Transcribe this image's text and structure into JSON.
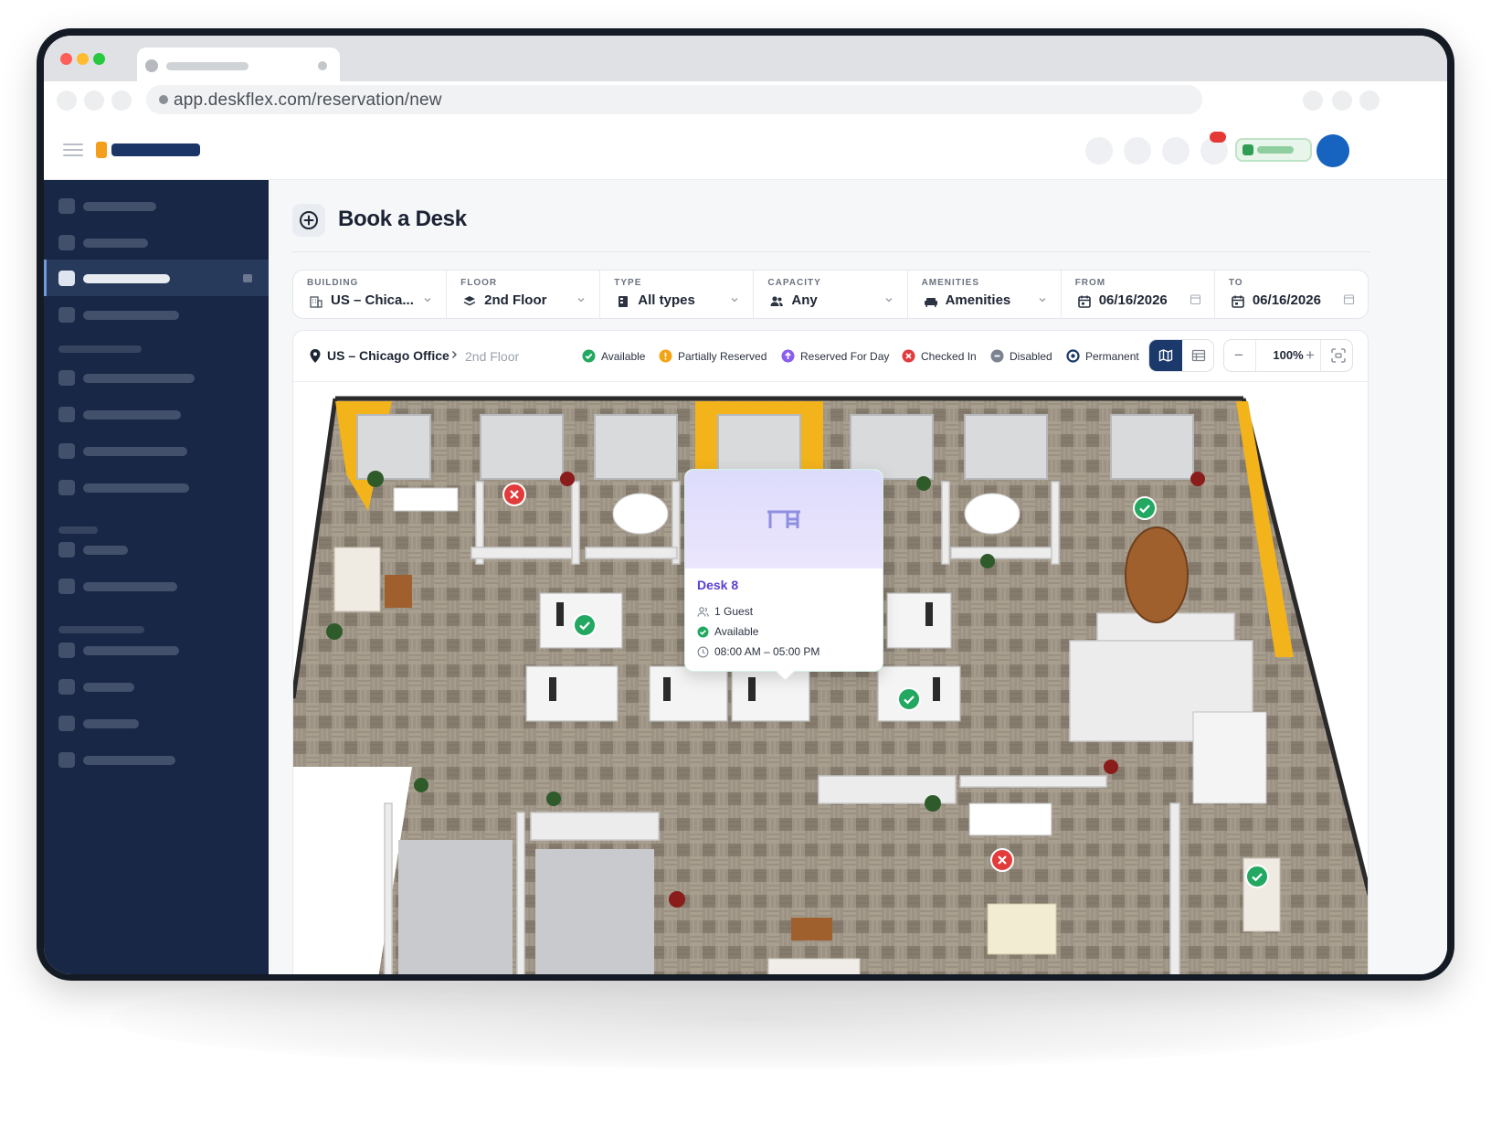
{
  "browser": {
    "url": "app.deskflex.com/reservation/new"
  },
  "page": {
    "title": "Book a Desk"
  },
  "filters": [
    {
      "label": "BUILDING",
      "value": "US – Chica...",
      "icon": "building-icon"
    },
    {
      "label": "FLOOR",
      "value": "2nd Floor",
      "icon": "layers-icon"
    },
    {
      "label": "TYPE",
      "value": "All types",
      "icon": "desk-type-icon"
    },
    {
      "label": "CAPACITY",
      "value": "Any",
      "icon": "users-icon"
    },
    {
      "label": "AMENITIES",
      "value": "Amenities",
      "icon": "sofa-icon"
    },
    {
      "label": "FROM",
      "value": "06/16/2026",
      "icon": "calendar-icon"
    },
    {
      "label": "TO",
      "value": "06/16/2026",
      "icon": "calendar-icon"
    }
  ],
  "breadcrumb": {
    "office": "US – Chicago Office",
    "floor": "2nd Floor"
  },
  "legend": [
    {
      "label": "Available",
      "color": "#22a861",
      "icon": "check-circle-icon"
    },
    {
      "label": "Partially Reserved",
      "color": "#f2a413",
      "icon": "exclamation-circle-icon"
    },
    {
      "label": "Reserved For Day",
      "color": "#8a5cf0",
      "icon": "arrow-up-circle-icon"
    },
    {
      "label": "Checked In",
      "color": "#e23b3b",
      "icon": "x-circle-icon"
    },
    {
      "label": "Disabled",
      "color": "#7b8290",
      "icon": "minus-circle-icon"
    },
    {
      "label": "Permanent",
      "color": "#1b3a6b",
      "icon": "ring-circle-icon"
    }
  ],
  "zoom": {
    "value": "100%",
    "minus": "−",
    "plus": "+"
  },
  "popup": {
    "title": "Desk 8",
    "capacity": "1 Guest",
    "status": "Available",
    "hours": "08:00 AM – 05:00 PM"
  },
  "colors": {
    "sidebar": "#172745",
    "accent": "#1b3a6b",
    "available": "#22a861",
    "checked_in": "#e23b3b",
    "wall_accent": "#f2b31b"
  }
}
